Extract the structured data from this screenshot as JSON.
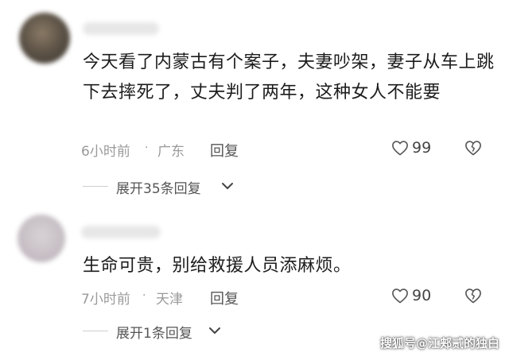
{
  "comments": [
    {
      "text": "今天看了内蒙古有个案子，夫妻吵架，妻子从车上跳下去摔死了，丈夫判了两年，这种女人不能要",
      "time": "6小时前",
      "separator": "·",
      "location": "广东",
      "reply_label": "回复",
      "likes": "99",
      "expand_label": "展开35条回复"
    },
    {
      "text": "生命可贵，别给救援人员添麻烦。",
      "time": "7小时前",
      "separator": "·",
      "location": "天津",
      "reply_label": "回复",
      "likes": "90",
      "expand_label": "展开1条回复"
    }
  ],
  "watermark": "搜狐号@江郏贰的独白",
  "icons": {
    "like": "heart-outline-icon",
    "dislike": "broken-heart-icon",
    "expand": "chevron-down-icon"
  }
}
